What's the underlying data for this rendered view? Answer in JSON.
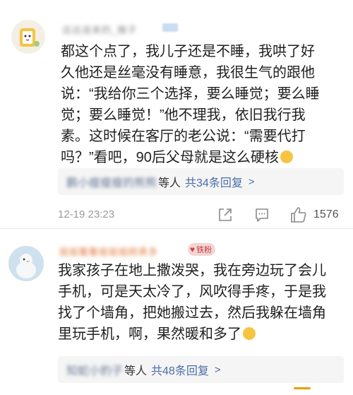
{
  "comments": [
    {
      "username": "远远追来的_猴子",
      "text_lines": [
        "都这个点了，我儿子还是不睡，我哄了好",
        "久他还是丝毫没有睡意，我很生气的跟他",
        "说：“我给你三个选择，要么睡觉；要么睡",
        "觉；要么睡觉！”他不理我，依旧我行我",
        "素。这时候在客厅的老公说：“需要代打",
        "吗？”看吧，90后父母就是这么硬核"
      ],
      "reply_names": "鹏小瘦瘦瘦的熊熊",
      "reply_suffix": "等人",
      "reply_count": "共34条回复",
      "reply_arrow": ">",
      "timestamp": "12-19 23:23",
      "likes": "1576",
      "icons": [
        "share-icon",
        "comment-icon",
        "like-icon"
      ]
    },
    {
      "username": "姐姐鳌鳌姐姐姐鸥黑多",
      "fan_badge": "铁粉",
      "text_lines": [
        "我家孩子在地上撒泼哭，我在旁边玩了会儿",
        "手机，可是天太冷了，风吹得手疼，于是我",
        "找了个墙角，把她搬过去，然后我躲在墙角",
        "里玩手机，啊，果然暖和多了"
      ],
      "reply_names": "知蛇小豹子",
      "reply_suffix": "等人",
      "reply_count": "共48条回复",
      "reply_arrow": ">"
    }
  ],
  "colors": {
    "link": "#4a6ea8",
    "muted": "#9a9a9a",
    "fan_badge_bg": "#f2d6d6"
  }
}
